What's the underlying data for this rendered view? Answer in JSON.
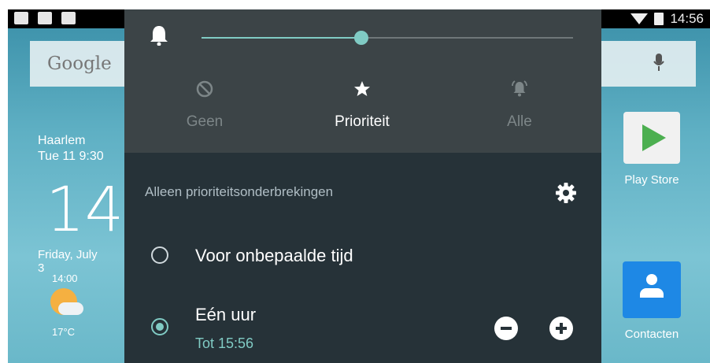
{
  "statusbar": {
    "time": "14:56"
  },
  "launcher": {
    "search_logo": "Google",
    "weather": {
      "city": "Haarlem",
      "date": "Tue 11 9:30",
      "time": "14:",
      "day": "Friday, July 3",
      "hour": "14:00",
      "temp": "17°C"
    },
    "apps": [
      {
        "label": "Play Store",
        "icon": "play-store-icon"
      },
      {
        "label": "Contacten",
        "icon": "contacts-icon"
      }
    ]
  },
  "panel": {
    "volume_level": 0.43,
    "modes": [
      {
        "label": "Geen",
        "icon": "block-icon",
        "selected": false
      },
      {
        "label": "Prioriteit",
        "icon": "star-icon",
        "selected": true
      },
      {
        "label": "Alle",
        "icon": "bell-icon",
        "selected": false
      }
    ],
    "header": "Alleen prioriteitsonderbrekingen",
    "options": [
      {
        "label": "Voor onbepaalde tijd",
        "selected": false
      },
      {
        "label": "Eén uur",
        "sublabel": "Tot 15:56",
        "selected": true
      }
    ]
  },
  "colors": {
    "accent": "#80cbc4",
    "panel_top": "#3c4447",
    "panel_bottom": "#263238"
  }
}
